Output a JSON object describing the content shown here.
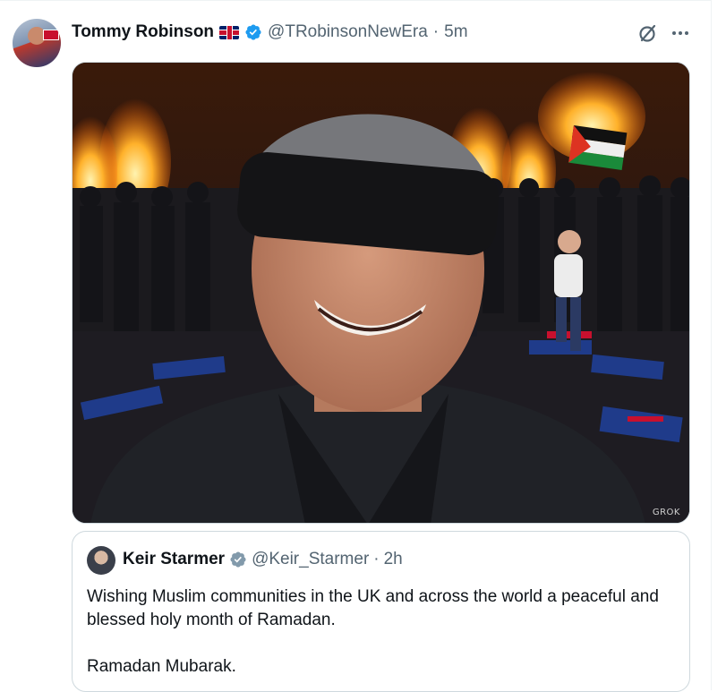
{
  "tweet": {
    "author_name": "Tommy Robinson",
    "handle": "@TRobinsonNewEra",
    "separator": "·",
    "time": "5m",
    "media_watermark": "GROK"
  },
  "quoted_tweet": {
    "author_name": "Keir Starmer",
    "handle": "@Keir_Starmer",
    "separator": "·",
    "time": "2h",
    "text_line1": "Wishing Muslim communities in the UK and across the world a peaceful and blessed holy month of Ramadan.",
    "text_line2": "Ramadan Mubarak."
  },
  "colors": {
    "verified_blue": "#1d9bf0",
    "verified_gray": "#829aab",
    "secondary_text": "#536471",
    "border": "#cfd9de"
  },
  "icons": [
    "uk-flag-icon",
    "verified-badge-icon",
    "grok-icon",
    "more-icon"
  ]
}
